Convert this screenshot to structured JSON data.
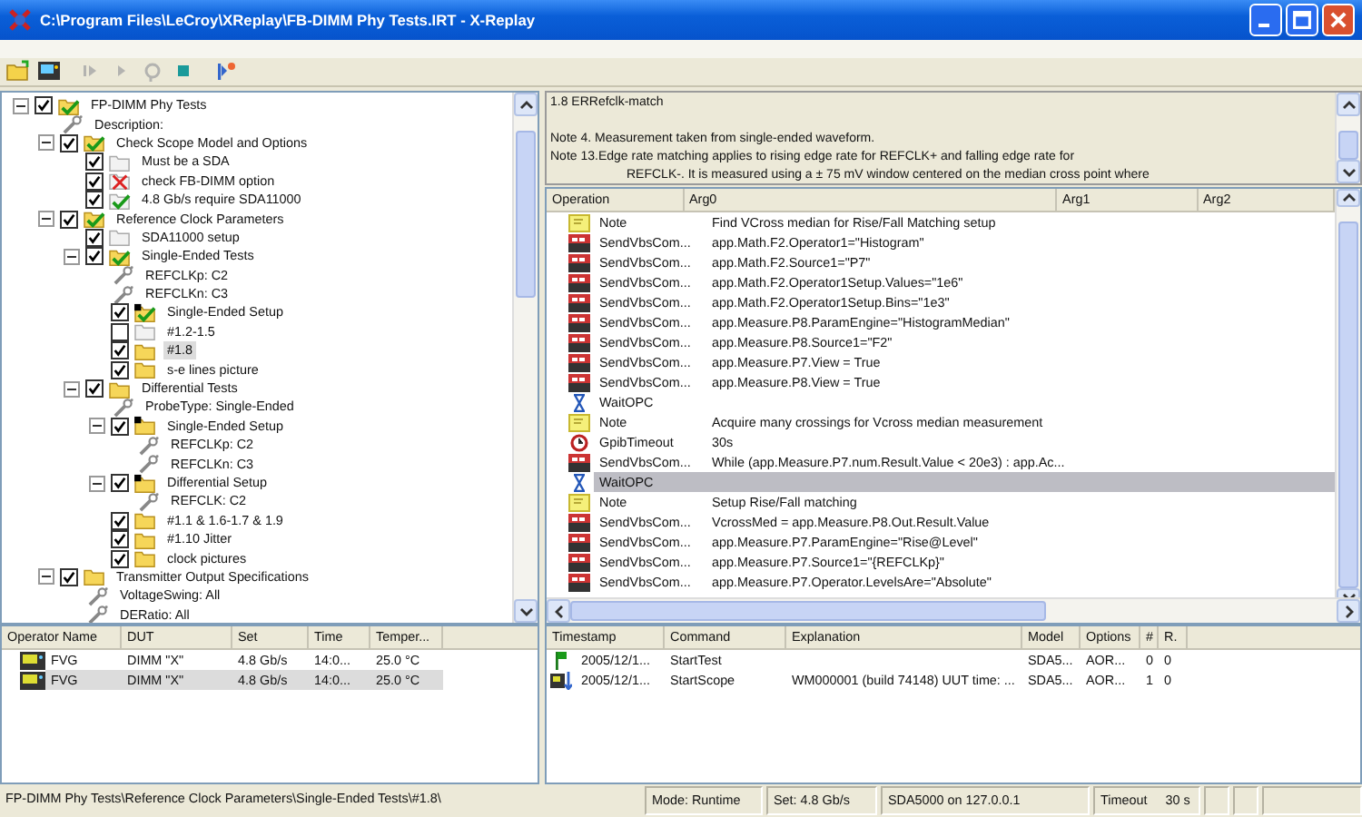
{
  "window": {
    "title": "C:\\Program Files\\LeCroy\\XReplay\\FB-DIMM Phy Tests.IRT - X-Replay"
  },
  "toolbar": [
    {
      "kind": "open",
      "disabled": false
    },
    {
      "kind": "scope",
      "disabled": false
    },
    {
      "kind": "pause",
      "disabled": true
    },
    {
      "kind": "play",
      "disabled": true
    },
    {
      "kind": "loop",
      "disabled": true
    },
    {
      "kind": "stop",
      "disabled": false
    },
    {
      "kind": "step",
      "disabled": false
    }
  ],
  "tree": [
    {
      "label": "FP-DIMM Phy Tests",
      "kind": "folder",
      "checked": true,
      "passed": true,
      "failed": false,
      "expanded": true,
      "selected": false,
      "children": [
        {
          "label": "Description:",
          "kind": "param",
          "selected": false
        },
        {
          "label": "Check Scope Model and Options",
          "kind": "folder",
          "checked": true,
          "passed": true,
          "failed": false,
          "expanded": true,
          "selected": false,
          "children": [
            {
              "label": "Must be a SDA",
              "kind": "page",
              "checked": true,
              "passed": false,
              "failed": false,
              "selected": false
            },
            {
              "label": "check FB-DIMM option",
              "kind": "page",
              "checked": true,
              "passed": false,
              "failed": true,
              "selected": false
            },
            {
              "label": "4.8 Gb/s require SDA11000",
              "kind": "page",
              "checked": true,
              "passed": true,
              "failed": false,
              "selected": false
            }
          ]
        },
        {
          "label": "Reference Clock Parameters",
          "kind": "folder",
          "checked": true,
          "passed": true,
          "failed": false,
          "expanded": true,
          "selected": false,
          "children": [
            {
              "label": "SDA11000 setup",
              "kind": "page",
              "checked": true,
              "passed": false,
              "failed": false,
              "selected": false
            },
            {
              "label": "Single-Ended Tests",
              "kind": "folder",
              "checked": true,
              "passed": true,
              "failed": false,
              "expanded": true,
              "selected": false,
              "children": [
                {
                  "label": "REFCLKp: C2",
                  "kind": "param",
                  "selected": false
                },
                {
                  "label": "REFCLKn: C3",
                  "kind": "param",
                  "selected": false
                },
                {
                  "label": "Single-Ended Setup",
                  "kind": "setup",
                  "checked": true,
                  "passed": true,
                  "failed": false,
                  "selected": false
                },
                {
                  "label": "#1.2-1.5",
                  "kind": "page",
                  "checked": false,
                  "passed": false,
                  "failed": false,
                  "selected": false
                },
                {
                  "label": "#1.8",
                  "kind": "folder",
                  "checked": true,
                  "passed": false,
                  "failed": false,
                  "selected": true
                },
                {
                  "label": "s-e lines picture",
                  "kind": "folder",
                  "checked": true,
                  "passed": false,
                  "failed": false,
                  "selected": false
                }
              ]
            },
            {
              "label": "Differential Tests",
              "kind": "folder",
              "checked": true,
              "passed": false,
              "failed": false,
              "expanded": true,
              "selected": false,
              "children": [
                {
                  "label": "ProbeType: Single-Ended",
                  "kind": "param",
                  "selected": false
                },
                {
                  "label": "Single-Ended Setup",
                  "kind": "setup",
                  "checked": true,
                  "passed": false,
                  "failed": false,
                  "expanded": true,
                  "selected": false,
                  "children": [
                    {
                      "label": "REFCLKp: C2",
                      "kind": "param",
                      "selected": false
                    },
                    {
                      "label": "REFCLKn: C3",
                      "kind": "param",
                      "selected": false
                    }
                  ]
                },
                {
                  "label": "Differential Setup",
                  "kind": "setup",
                  "checked": true,
                  "passed": false,
                  "failed": false,
                  "expanded": true,
                  "selected": false,
                  "children": [
                    {
                      "label": "REFCLK: C2",
                      "kind": "param",
                      "selected": false
                    }
                  ]
                },
                {
                  "label": "#1.1 & 1.6-1.7 & 1.9",
                  "kind": "folder",
                  "checked": true,
                  "passed": false,
                  "failed": false,
                  "selected": false
                },
                {
                  "label": "#1.10 Jitter",
                  "kind": "folder",
                  "checked": true,
                  "passed": false,
                  "failed": false,
                  "selected": false
                },
                {
                  "label": "clock pictures",
                  "kind": "folder",
                  "checked": true,
                  "passed": false,
                  "failed": false,
                  "selected": false
                }
              ]
            }
          ]
        },
        {
          "label": "Transmitter Output Specifications",
          "kind": "folder",
          "checked": true,
          "passed": false,
          "failed": false,
          "expanded": true,
          "selected": false,
          "children": [
            {
              "label": "VoltageSwing: All",
              "kind": "param",
              "selected": false
            },
            {
              "label": "DERatio: All",
              "kind": "param",
              "selected": false
            }
          ]
        }
      ]
    }
  ],
  "runs": {
    "columns": [
      "Operator Name",
      "DUT",
      "Set",
      "Time",
      "Temper..."
    ],
    "rows": [
      {
        "cells": [
          "FVG",
          "DIMM \"X\"",
          "4.8 Gb/s",
          "14:0...",
          "25.0 °C"
        ],
        "selected": false
      },
      {
        "cells": [
          "FVG",
          "DIMM \"X\"",
          "4.8 Gb/s",
          "14:0...",
          "25.0 °C"
        ],
        "selected": true
      }
    ]
  },
  "notes": {
    "heading": "1.8 ERRefclk-match",
    "lines": [
      {
        "text": "Note 4. Measurement taken from single-ended waveform.",
        "indent": false
      },
      {
        "text": "Note 13.Edge rate matching applies to rising edge rate for REFCLK+ and falling edge rate for",
        "indent": false
      },
      {
        "text": "REFCLK-. It is measured using a ± 75 mV window centered on the median cross point where",
        "indent": true
      }
    ]
  },
  "operations": {
    "columns": [
      "Operation",
      "Arg0",
      "Arg1",
      "Arg2"
    ],
    "rows": [
      {
        "kind": "note",
        "operation": "Note",
        "arg0": "Find VCross median for Rise/Fall Matching setup",
        "selected": false
      },
      {
        "kind": "vbs",
        "operation": "SendVbsCom...",
        "arg0": "app.Math.F2.Operator1=\"Histogram\"",
        "selected": false
      },
      {
        "kind": "vbs",
        "operation": "SendVbsCom...",
        "arg0": "app.Math.F2.Source1=\"P7\"",
        "selected": false
      },
      {
        "kind": "vbs",
        "operation": "SendVbsCom...",
        "arg0": "app.Math.F2.Operator1Setup.Values=\"1e6\"",
        "selected": false
      },
      {
        "kind": "vbs",
        "operation": "SendVbsCom...",
        "arg0": "app.Math.F2.Operator1Setup.Bins=\"1e3\"",
        "selected": false
      },
      {
        "kind": "vbs",
        "operation": "SendVbsCom...",
        "arg0": "app.Measure.P8.ParamEngine=\"HistogramMedian\"",
        "selected": false
      },
      {
        "kind": "vbs",
        "operation": "SendVbsCom...",
        "arg0": "app.Measure.P8.Source1=\"F2\"",
        "selected": false
      },
      {
        "kind": "vbs",
        "operation": "SendVbsCom...",
        "arg0": "app.Measure.P7.View = True",
        "selected": false
      },
      {
        "kind": "vbs",
        "operation": "SendVbsCom...",
        "arg0": "app.Measure.P8.View = True",
        "selected": false
      },
      {
        "kind": "wait",
        "operation": "WaitOPC",
        "selected": false
      },
      {
        "kind": "note",
        "operation": "Note",
        "arg0": "Acquire many crossings for Vcross median measurement",
        "selected": false
      },
      {
        "kind": "timeout",
        "operation": "GpibTimeout",
        "arg0": "30s",
        "selected": false
      },
      {
        "kind": "vbs",
        "operation": "SendVbsCom...",
        "arg0": "While (app.Measure.P7.num.Result.Value < 20e3) : app.Ac...",
        "selected": false
      },
      {
        "kind": "wait",
        "operation": "WaitOPC",
        "selected": true
      },
      {
        "kind": "note",
        "operation": "Note",
        "arg0": "Setup Rise/Fall matching",
        "selected": false
      },
      {
        "kind": "vbs",
        "operation": "SendVbsCom...",
        "arg0": "VcrossMed = app.Measure.P8.Out.Result.Value",
        "selected": false
      },
      {
        "kind": "vbs",
        "operation": "SendVbsCom...",
        "arg0": "app.Measure.P7.ParamEngine=\"Rise@Level\"",
        "selected": false
      },
      {
        "kind": "vbs",
        "operation": "SendVbsCom...",
        "arg0": "app.Measure.P7.Source1=\"{REFCLKp}\"",
        "selected": false
      },
      {
        "kind": "vbs",
        "operation": "SendVbsCom...",
        "arg0": "app.Measure.P7.Operator.LevelsAre=\"Absolute\"",
        "selected": false
      }
    ]
  },
  "log": {
    "columns": [
      "Timestamp",
      "Command",
      "Explanation",
      "Model",
      "Options",
      "#",
      "R."
    ],
    "rows": [
      {
        "kind": "start",
        "cells": [
          "2005/12/1...",
          "StartTest",
          "",
          "SDA5...",
          "AOR...",
          "0",
          "0"
        ]
      },
      {
        "kind": "scope",
        "cells": [
          "2005/12/1...",
          "StartScope",
          "WM000001 (build 74148)  UUT time: ...",
          "SDA5...",
          "AOR...",
          "1",
          "0"
        ]
      }
    ]
  },
  "status_bar": {
    "path": "FP-DIMM Phy Tests\\Reference Clock Parameters\\Single-Ended Tests\\#1.8\\",
    "mode": "Mode: Runtime",
    "set": "Set: 4.8 Gb/s",
    "connection": "SDA5000 on 127.0.0.1",
    "timeout_label": "Timeout",
    "timeout_value": "30 s"
  }
}
